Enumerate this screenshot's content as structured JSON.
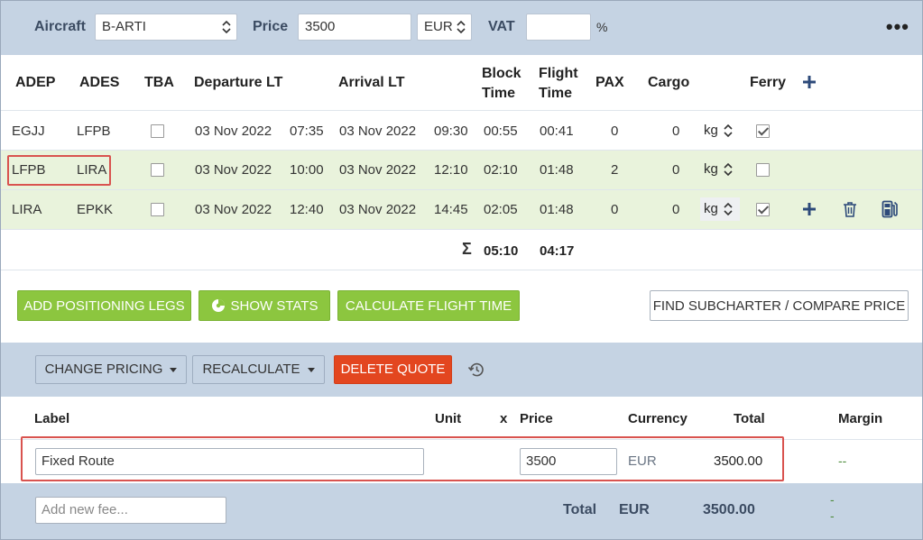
{
  "topbar": {
    "aircraft_label": "Aircraft",
    "aircraft_value": "B-ARTI",
    "price_label": "Price",
    "price_value": "3500",
    "currency_value": "EUR",
    "vat_label": "VAT",
    "vat_value": "",
    "percent_sign": "%",
    "more_icon": "more-horizontal-icon"
  },
  "legs": {
    "headers": {
      "adep": "ADEP",
      "ades": "ADES",
      "tba": "TBA",
      "departure": "Departure LT",
      "arrival": "Arrival LT",
      "block_time_1": "Block",
      "block_time_2": "Time",
      "flight_time_1": "Flight",
      "flight_time_2": "Time",
      "pax": "PAX",
      "cargo": "Cargo",
      "ferry": "Ferry"
    },
    "rows": [
      {
        "adep": "EGJJ",
        "ades": "LFPB",
        "tba": false,
        "dep_date": "03 Nov 2022",
        "dep_time": "07:35",
        "arr_date": "03 Nov 2022",
        "arr_time": "09:30",
        "block": "00:55",
        "flight": "00:41",
        "pax": "0",
        "cargo": "0",
        "unit": "kg",
        "ferry": true
      },
      {
        "adep": "LFPB",
        "ades": "LIRA",
        "tba": false,
        "dep_date": "03 Nov 2022",
        "dep_time": "10:00",
        "arr_date": "03 Nov 2022",
        "arr_time": "12:10",
        "block": "02:10",
        "flight": "01:48",
        "pax": "2",
        "cargo": "0",
        "unit": "kg",
        "ferry": false
      },
      {
        "adep": "LIRA",
        "ades": "EPKK",
        "tba": false,
        "dep_date": "03 Nov 2022",
        "dep_time": "12:40",
        "arr_date": "03 Nov 2022",
        "arr_time": "14:45",
        "block": "02:05",
        "flight": "01:48",
        "pax": "0",
        "cargo": "0",
        "unit": "kg",
        "ferry": true
      }
    ],
    "totals": {
      "sigma": "Σ",
      "block": "05:10",
      "flight": "04:17"
    },
    "colors": {
      "row_highlight": "#e9f3dc",
      "accent_blue": "#2d4a7a",
      "highlight_border": "#d9534f"
    }
  },
  "actions": {
    "add_positioning": "ADD POSITIONING LEGS",
    "show_stats": "SHOW STATS",
    "calculate_time": "CALCULATE FLIGHT TIME",
    "find_subcharter": "FIND SUBCHARTER / COMPARE PRICE"
  },
  "pricing": {
    "change_pricing": "CHANGE PRICING",
    "recalculate": "RECALCULATE",
    "delete_quote": "DELETE QUOTE",
    "headers": {
      "label": "Label",
      "unit": "Unit",
      "x": "x",
      "price": "Price",
      "currency": "Currency",
      "total": "Total",
      "margin": "Margin"
    },
    "fees": [
      {
        "label": "Fixed Route",
        "unit": "",
        "price": "3500",
        "currency": "EUR",
        "total": "3500.00",
        "margin": "--"
      }
    ],
    "new_fee_placeholder": "Add new fee...",
    "footer": {
      "total_label": "Total",
      "currency": "EUR",
      "amount": "3500.00",
      "margin_1": "-",
      "margin_2": "-"
    }
  }
}
